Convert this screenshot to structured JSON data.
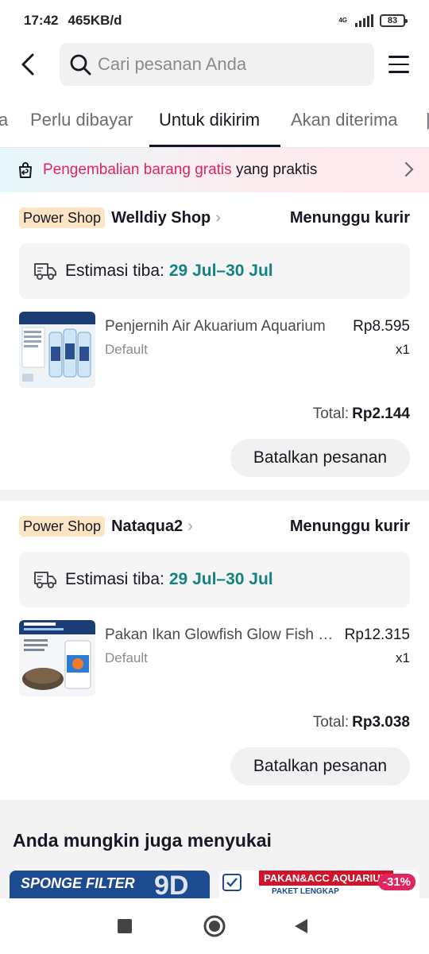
{
  "status_bar": {
    "time": "17:42",
    "speed": "465KB/d",
    "network": "4G",
    "battery": "83"
  },
  "search": {
    "placeholder": "Cari pesanan Anda"
  },
  "tabs": [
    {
      "label": "a"
    },
    {
      "label": "Perlu dibayar"
    },
    {
      "label": "Untuk dikirim"
    },
    {
      "label": "Akan diterima"
    }
  ],
  "banner": {
    "highlight": "Pengembalian barang gratis",
    "text": " yang praktis"
  },
  "orders": [
    {
      "badge": "Power Shop",
      "shop": "Welldiy Shop",
      "status": "Menunggu kurir",
      "eta_label": "Estimasi tiba:",
      "eta_date": "29 Jul–30 Jul",
      "product": {
        "name": "Penjernih Air Akuarium Aquarium",
        "variant": "Default",
        "price": "Rp8.595",
        "qty": "x1"
      },
      "total_label": "Total:",
      "total": "Rp2.144",
      "cancel": "Batalkan pesanan"
    },
    {
      "badge": "Power Shop",
      "shop": "Nataqua2",
      "status": "Menunggu kurir",
      "eta_label": "Estimasi tiba:",
      "eta_date": "29 Jul–30 Jul",
      "product": {
        "name": "Pakan Ikan Glowfish Glow Fish Pellet",
        "variant": "Default",
        "price": "Rp12.315",
        "qty": "x1"
      },
      "total_label": "Total:",
      "total": "Rp3.038",
      "cancel": "Batalkan pesanan"
    }
  ],
  "recommend": {
    "title": "Anda mungkin juga menyukai",
    "card1_text": "SPONGE FILTER",
    "card2_top": "PAKAN&ACC AQUARIUM",
    "card2_sub": "PAKET LENGKAP",
    "card2_discount": "-31%"
  },
  "colors": {
    "accent_pink": "#e0245e",
    "eta_teal": "#138282",
    "badge_bg": "#fde5c3"
  }
}
